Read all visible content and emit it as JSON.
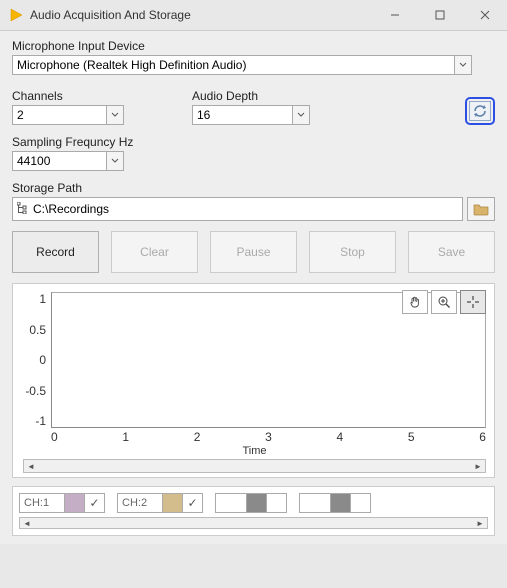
{
  "window": {
    "title": "Audio Acquisition And Storage"
  },
  "device": {
    "label": "Microphone Input Device",
    "value": "Microphone (Realtek High Definition Audio)"
  },
  "channels": {
    "label": "Channels",
    "value": "2"
  },
  "depth": {
    "label": "Audio Depth",
    "value": "16"
  },
  "sampling": {
    "label": "Sampling Frequncy Hz",
    "value": "44100"
  },
  "storage": {
    "label": "Storage Path",
    "value": "C:\\Recordings"
  },
  "buttons": {
    "record": "Record",
    "clear": "Clear",
    "pause": "Pause",
    "stop": "Stop",
    "save": "Save"
  },
  "chart": {
    "xlabel": "Time"
  },
  "chart_data": {
    "type": "line",
    "title": "",
    "xlabel": "Time",
    "ylabel": "",
    "xlim": [
      0,
      6
    ],
    "ylim": [
      -1,
      1
    ],
    "xticks": [
      0,
      1,
      2,
      3,
      4,
      5,
      6
    ],
    "yticks": [
      -1,
      -0.5,
      0,
      0.5,
      1
    ],
    "series": [
      {
        "name": "CH:1",
        "color": "#c4aec6",
        "values": []
      },
      {
        "name": "CH:2",
        "color": "#d3bd8c",
        "values": []
      }
    ]
  },
  "legend": {
    "items": [
      {
        "name": "CH:1",
        "color": "#c4aec6",
        "checked": true
      },
      {
        "name": "CH:2",
        "color": "#d3bd8c",
        "checked": true
      },
      {
        "name": "",
        "color": "#8a8a8a",
        "checked": false
      },
      {
        "name": "",
        "color": "#8a8a8a",
        "checked": false
      }
    ]
  }
}
